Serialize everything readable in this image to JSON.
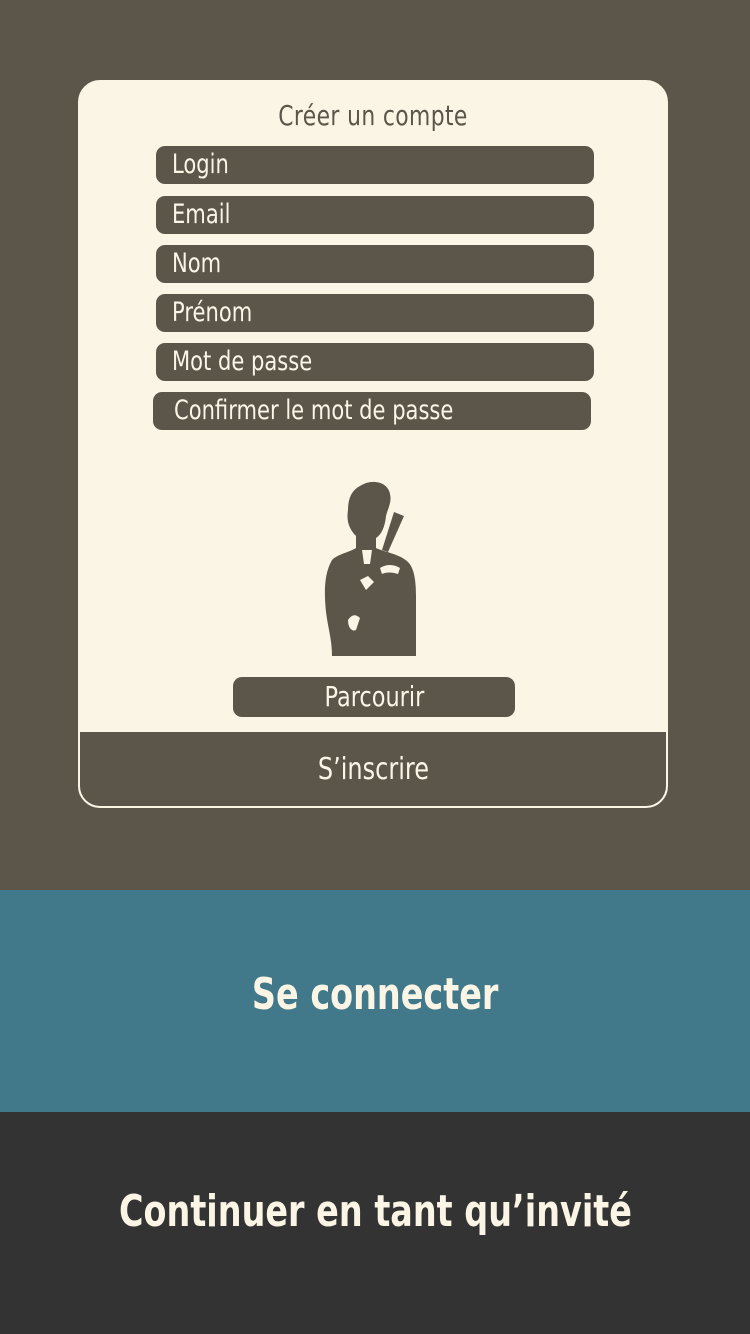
{
  "register_form": {
    "title": "Créer un compte",
    "fields": [
      {
        "placeholder": "Login"
      },
      {
        "placeholder": "Email"
      },
      {
        "placeholder": "Nom"
      },
      {
        "placeholder": "Prénom"
      },
      {
        "placeholder": "Mot de passe"
      },
      {
        "placeholder": "Confirmer le mot de passe"
      }
    ],
    "avatar_icon": "spy-silhouette-icon",
    "browse_label": "Parcourir",
    "submit_label": "S’inscrire"
  },
  "login_label": "Se connecter",
  "guest_label": "Continuer en tant qu’invité",
  "colors": {
    "background": "#5c554a",
    "card": "#fbf5e5",
    "login": "#41788a",
    "guest": "#333333"
  }
}
